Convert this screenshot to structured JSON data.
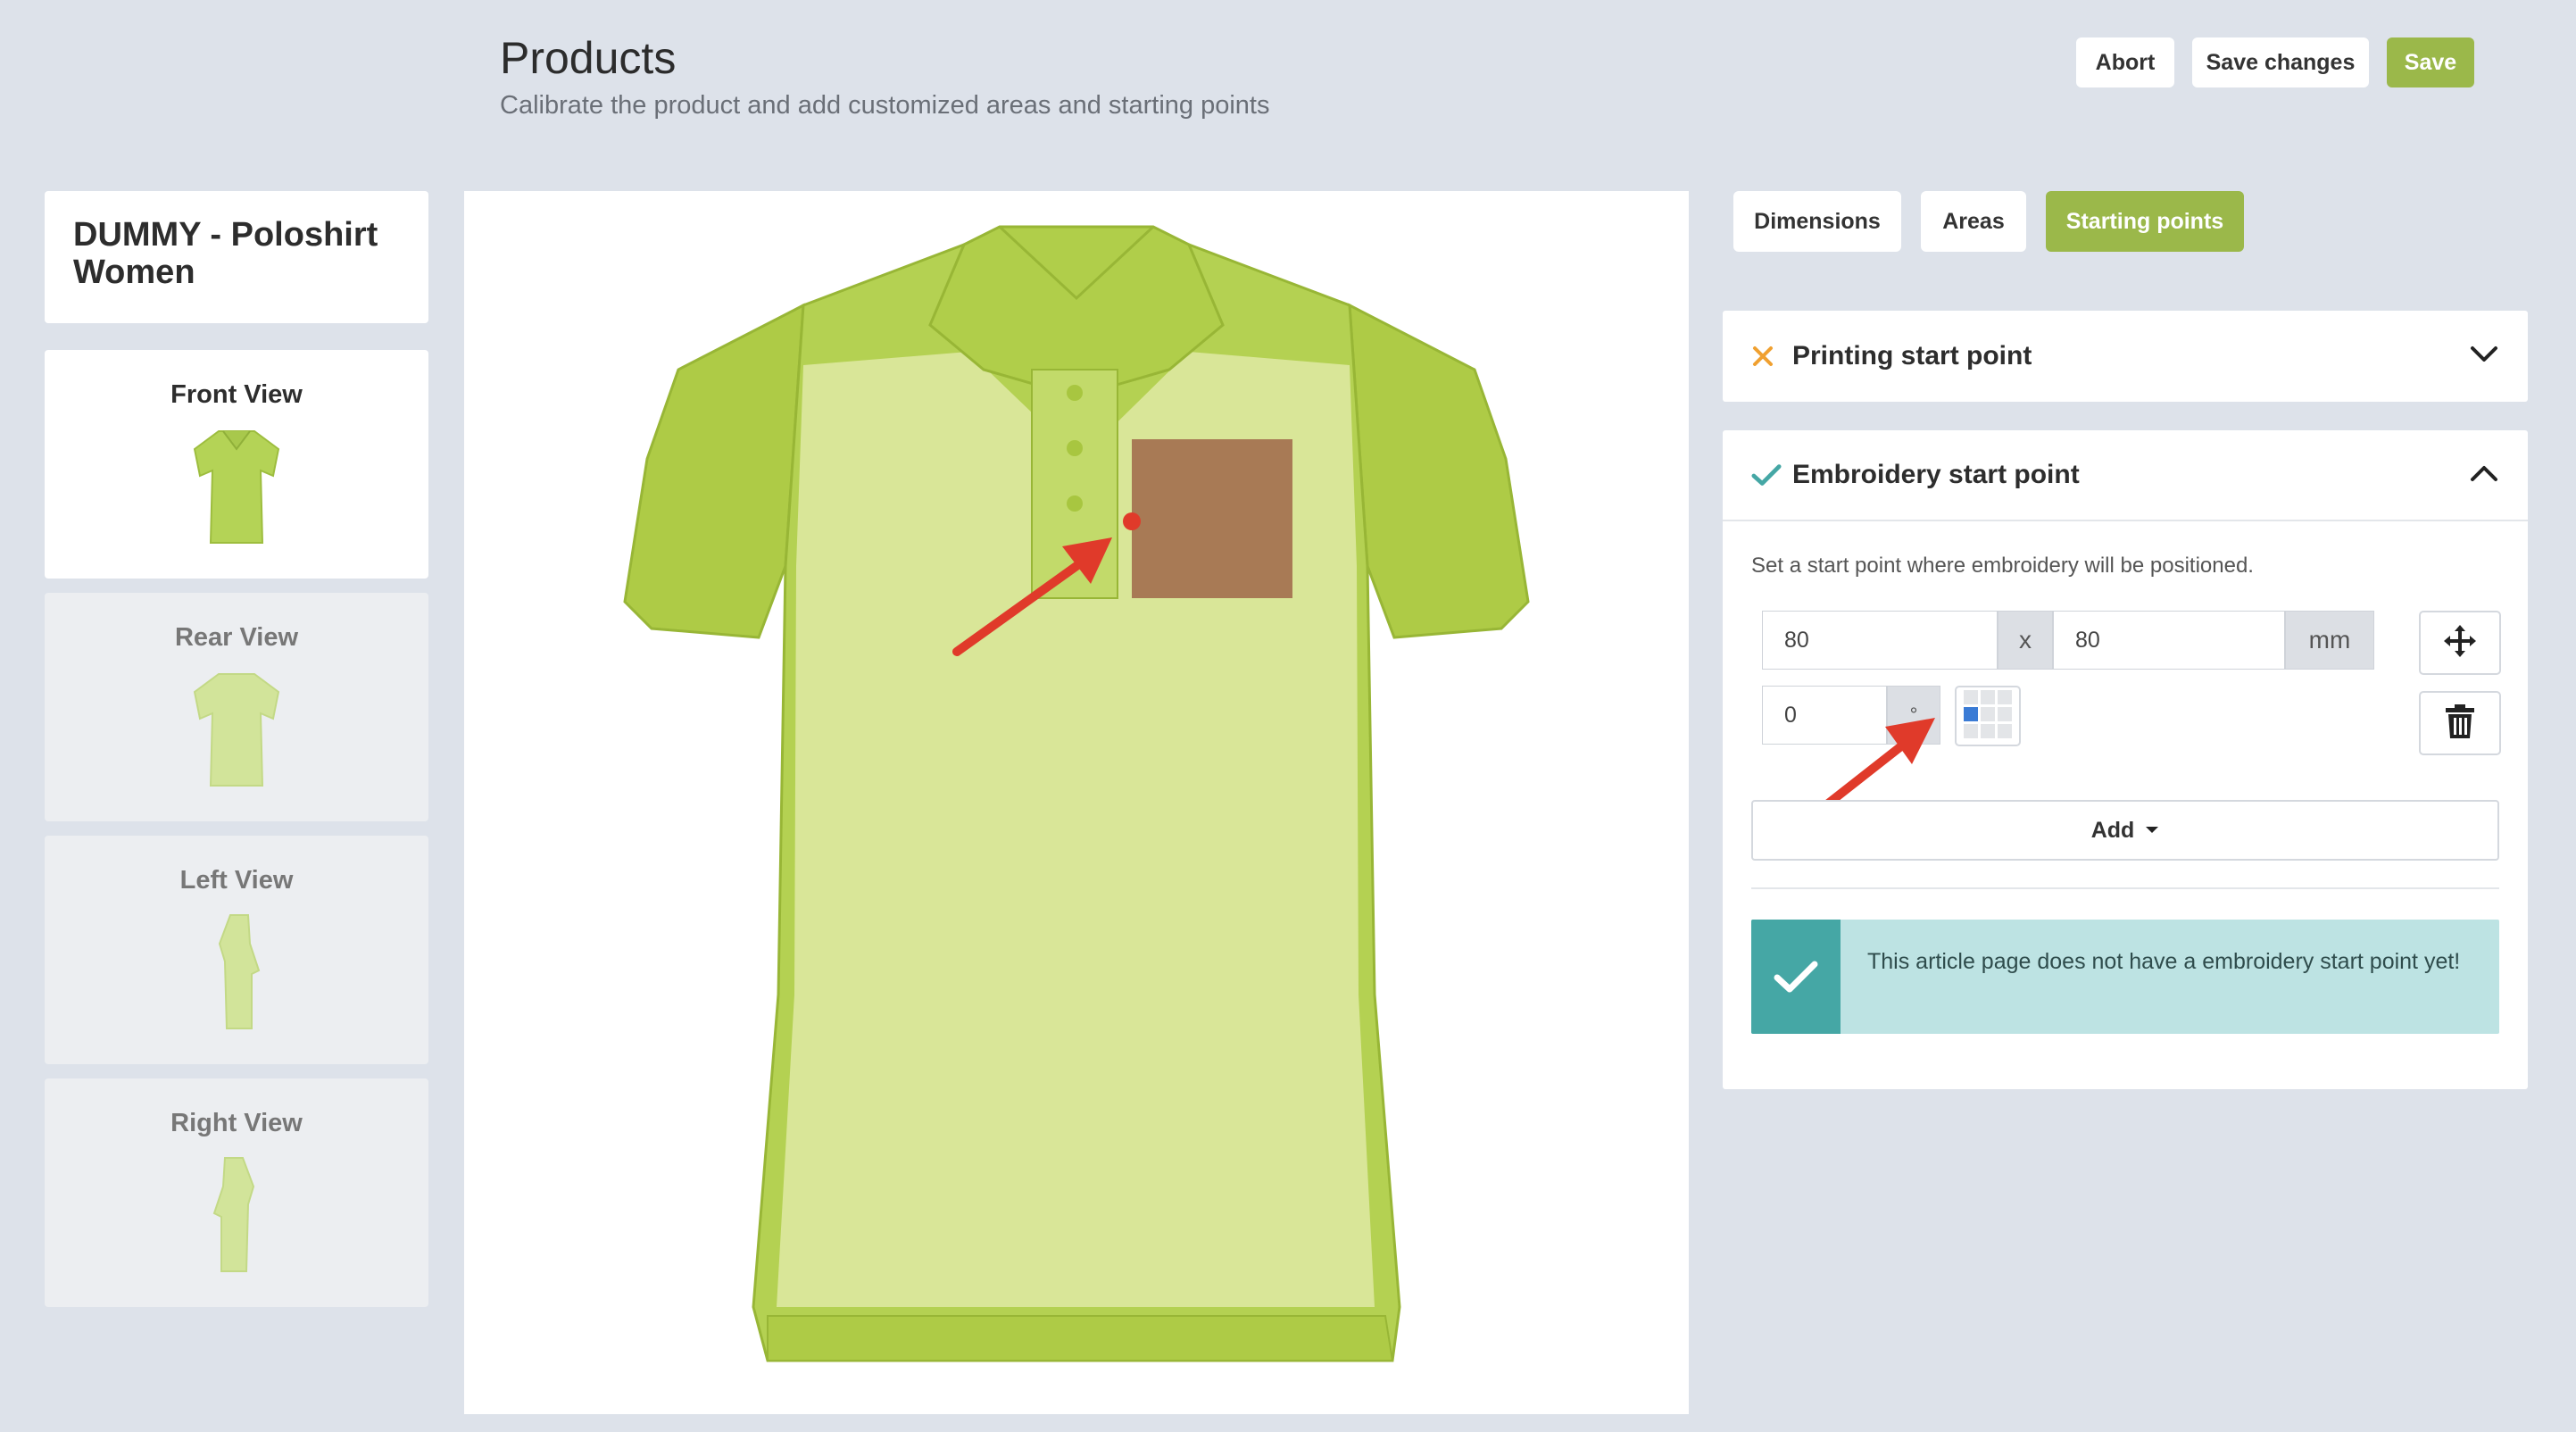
{
  "header": {
    "title": "Products",
    "subtitle": "Calibrate the product and add customized areas and starting points",
    "buttons": {
      "abort": "Abort",
      "save_changes": "Save changes",
      "save": "Save"
    }
  },
  "sidebar": {
    "product_name": "DUMMY - Poloshirt Women",
    "views": [
      {
        "label": "Front View",
        "active": true
      },
      {
        "label": "Rear View",
        "active": false
      },
      {
        "label": "Left View",
        "active": false
      },
      {
        "label": "Right View",
        "active": false
      }
    ]
  },
  "tabs": [
    {
      "label": "Dimensions",
      "active": false
    },
    {
      "label": "Areas",
      "active": false
    },
    {
      "label": "Starting points",
      "active": true
    }
  ],
  "printing": {
    "title": "Printing start point",
    "status_icon": "x-icon",
    "expanded": false
  },
  "embroidery": {
    "title": "Embroidery start point",
    "status_icon": "check-icon",
    "expanded": true,
    "hint": "Set a start point where embroidery will be positioned.",
    "x_value": "80",
    "x_sep": "x",
    "y_value": "80",
    "unit": "mm",
    "rotation_value": "0",
    "rotation_unit": "°",
    "add_label": "Add",
    "notice": "This article page does not have a embroidery start point yet!"
  },
  "colors": {
    "accent_green": "#9bb84a",
    "shirt": "#b8d65a",
    "area_fill": "#a87a55",
    "marker": "#e03a2a",
    "notice_bg": "#bde3e3",
    "notice_icon_bg": "#45a7a5"
  }
}
